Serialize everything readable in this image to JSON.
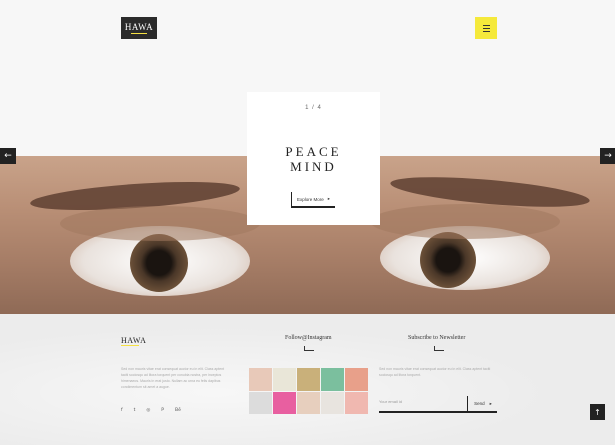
{
  "header": {
    "logo": "HAWA"
  },
  "hero": {
    "prev_arrow": "←",
    "next_arrow": "→"
  },
  "slide_card": {
    "counter": "1 / 4",
    "title_line1": "PEACE",
    "title_line2": "MIND",
    "button_label": "Explore More",
    "button_arrow": "▸"
  },
  "footer": {
    "logo": "HAWA",
    "about_text": "Sed non mauris vitae erat consequat auctor eu in elit. Class aptent taciti sociosqu ad litora torquent per conubia nostra, per inceptos himenaeos. Mauris in erat justo. Nullam ac urna eu felis dapibus condimentum sit amet a augue.",
    "social_icons": [
      "f",
      "t",
      "◎",
      "P",
      "Bē"
    ],
    "instagram_title": "Follow@Instagram",
    "instagram_colors": [
      "#e8c9b9",
      "#e9e6d8",
      "#c9b07a",
      "#7bbf9e",
      "#e8a08a",
      "#dcdcdc",
      "#e85fa0",
      "#e7cfbe",
      "#e8e4df",
      "#f0b8b0"
    ],
    "newsletter_title": "Subscribe to Newsletter",
    "newsletter_text": "Sed non mauris vitae erat consequat auctor eu in elit. Class aptent taciti sociosqu ad litora torquent.",
    "email_placeholder": "Your email id",
    "send_label": "Send",
    "send_arrow": "▸",
    "back_to_top": "↑"
  },
  "colors": {
    "accent": "#f5e93b",
    "dark": "#222222"
  }
}
